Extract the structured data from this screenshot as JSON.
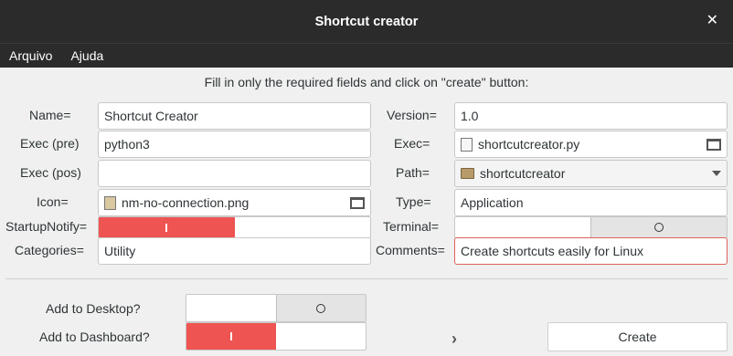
{
  "window": {
    "title": "Shortcut creator",
    "close_glyph": "✕"
  },
  "menu": {
    "items": [
      "Arquivo",
      "Ajuda"
    ]
  },
  "instruction": "Fill in only the required fields and click on \"create\" button:",
  "left": {
    "name_label": "Name=",
    "name_value": "Shortcut Creator",
    "exec_pre_label": "Exec (pre)",
    "exec_pre_value": "python3",
    "exec_pos_label": "Exec (pos)",
    "exec_pos_value": "",
    "icon_label": "Icon=",
    "icon_value": "nm-no-connection.png",
    "startup_label": "StartupNotify=",
    "startup_state": "on",
    "categories_label": "Categories=",
    "categories_value": "Utility"
  },
  "right": {
    "version_label": "Version=",
    "version_value": "1.0",
    "exec_label": "Exec=",
    "exec_value": "shortcutcreator.py",
    "path_label": "Path=",
    "path_value": "shortcutcreator",
    "type_label": "Type=",
    "type_value": "Application",
    "terminal_label": "Terminal=",
    "terminal_state": "off",
    "comments_label": "Comments=",
    "comments_value": "Create shortcuts easily for Linux"
  },
  "bottom": {
    "desktop_label": "Add to Desktop?",
    "desktop_state": "off",
    "dashboard_label": "Add to Dashboard?",
    "dashboard_state": "on",
    "create_label": "Create",
    "arrow_glyph": "›"
  },
  "switch_glyphs": {
    "on": "I",
    "off": "O"
  },
  "colors": {
    "switch_on": "#ee5451",
    "titlebar": "#2b2b2b",
    "background": "#f0f0f0"
  }
}
